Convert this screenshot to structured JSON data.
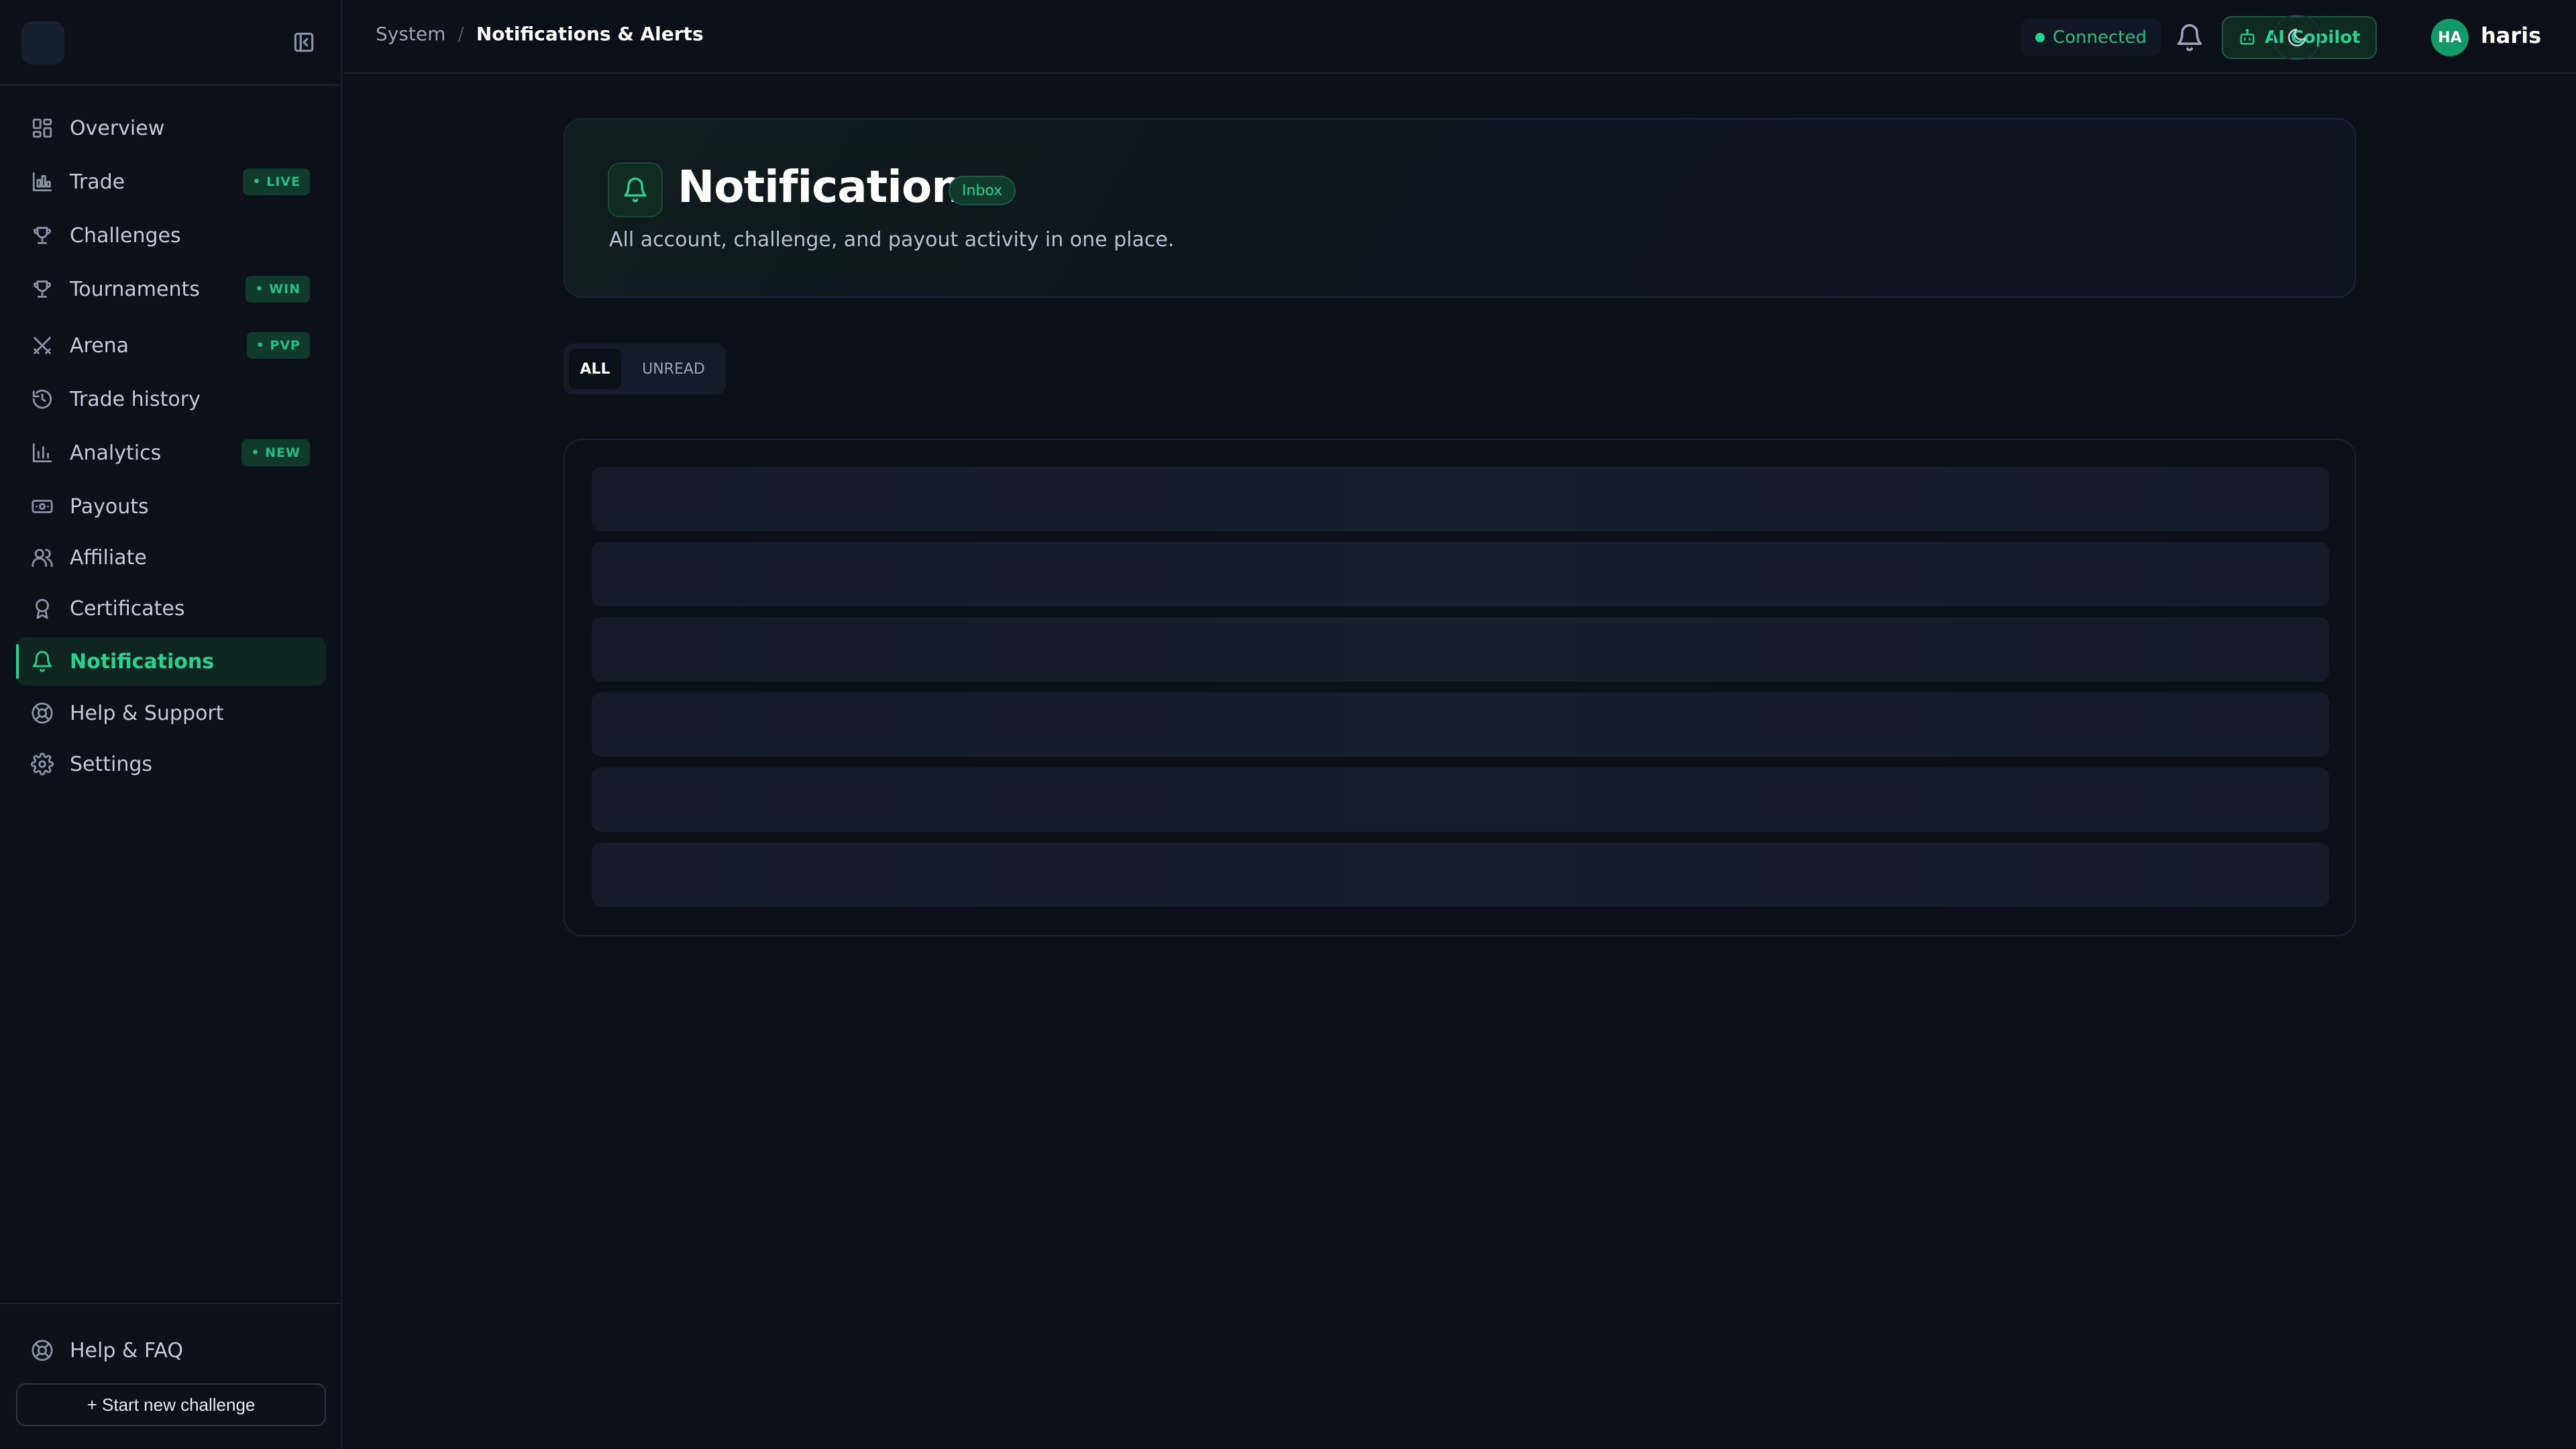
{
  "sidebar": {
    "items": [
      {
        "label": "Overview",
        "icon": "grid-icon",
        "badge": ""
      },
      {
        "label": "Trade",
        "icon": "chart-icon",
        "badge": "• LIVE"
      },
      {
        "label": "Challenges",
        "icon": "trophy-icon",
        "badge": ""
      },
      {
        "label": "Tournaments",
        "icon": "trophy-icon",
        "badge": "• WIN"
      },
      {
        "label": "Arena",
        "icon": "swords-icon",
        "badge": "• PVP"
      },
      {
        "label": "Trade history",
        "icon": "history-icon",
        "badge": ""
      },
      {
        "label": "Analytics",
        "icon": "bar-chart-icon",
        "badge": "• NEW"
      },
      {
        "label": "Payouts",
        "icon": "banknote-icon",
        "badge": ""
      },
      {
        "label": "Affiliate",
        "icon": "users-icon",
        "badge": ""
      },
      {
        "label": "Certificates",
        "icon": "award-icon",
        "badge": ""
      },
      {
        "label": "Notifications",
        "icon": "bell-icon",
        "badge": "",
        "active": true
      },
      {
        "label": "Help & Support",
        "icon": "lifebuoy-icon",
        "badge": ""
      },
      {
        "label": "Settings",
        "icon": "gear-icon",
        "badge": ""
      }
    ],
    "help_faq": "Help & FAQ",
    "start_button": "+ Start new challenge"
  },
  "header": {
    "breadcrumb_parent": "System",
    "breadcrumb_sep": "/",
    "breadcrumb_current": "Notifications & Alerts",
    "status": "Connected",
    "copilot_label": "AI Copilot",
    "avatar_initials": "HA",
    "username": "haris"
  },
  "hero": {
    "title": "Notifications",
    "badge": "Inbox",
    "subtitle": "All account, challenge, and payout activity in one place."
  },
  "tabs": {
    "all": "ALL",
    "unread": "UNREAD"
  },
  "colors": {
    "accent": "#22d391",
    "background": "#0b0f17",
    "sidebar": "#0c1119"
  }
}
